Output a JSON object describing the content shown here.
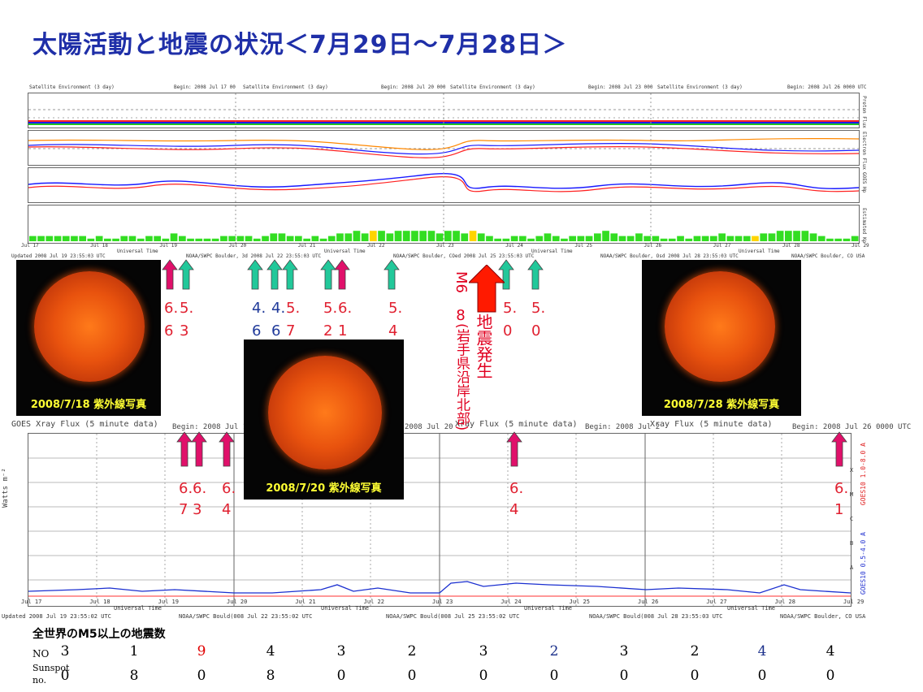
{
  "title": "太陽活動と地震の状況＜7月29日～7月28日＞",
  "top_chart": {
    "header_left": "Satellite Environment  (3 day)",
    "header_begin_1": "Begin:  2008 Jul 17 00",
    "header_mid": "Satellite Environment  (3 day)",
    "header_begin_2": "Begin:  2008 Jul 20 000",
    "header_mid2": "Satellite Environment  (3 day)",
    "header_begin_3": "Begin:  2008 Jul 23 000",
    "header_mid3": "Satellite Environment  (3 day)",
    "header_begin_4": "Begin:  2008 Jul 26 0000 UTC",
    "y_label_1": "Proton Flux",
    "y_label_2": "Electron Flux",
    "y_label_3": "GOES Hp",
    "y_label_4": "Estimated Kp",
    "day_labels": [
      "Jul 17",
      "Jul 18",
      "Jul 19",
      "Jul 20",
      "Jul 21",
      "Jul 22",
      "Jul 23",
      "Jul 24",
      "Jul 25",
      "Jul 26",
      "Jul 27",
      "Jul 28",
      "Jul 29"
    ],
    "universal_time": "Universal Time",
    "footer_1": "Updated 2008 Jul 19 23:55:03 UTC",
    "footer_2": "NOAA/SWPC Boulder, 3d 2008 Jul 22 23:55:03 UTC",
    "footer_3": "NOAA/SWPC Boulder, COed 2008 Jul 25 23:55:03 UTC",
    "footer_4": "NOAA/SWPC Boulder, Osd 2008 Jul 28 23:55:03 UTC",
    "footer_5": "NOAA/SWPC Boulder, CO USA"
  },
  "sun_images": [
    {
      "caption": "2008/7/18 紫外線写真"
    },
    {
      "caption": "2008/7/20 紫外線写真"
    },
    {
      "caption": "2008/7/28 紫外線写真"
    }
  ],
  "arrow_numbers": {
    "a1_top": "6.",
    "a1_bot": "6",
    "a2_top": "5.",
    "a2_bot": "3",
    "b1_top": "4.",
    "b1_bot": "6",
    "b2_top": "4.",
    "b2_bot": "6",
    "b3_top": "5.",
    "b3_bot": "7",
    "c1_top": "5.",
    "c1_bot": "2",
    "c2_top": "6.",
    "c2_bot": "1",
    "d_top": "5.",
    "d_bot": "4",
    "e_top": "5.",
    "e_bot": "0",
    "f_top": "5.",
    "f_bot": "0",
    "x1_top": "6.",
    "x1_bot": "7",
    "x2_top": "6.",
    "x2_bot": "3",
    "x3_top": "6.",
    "x3_bot": "4",
    "x4_top": "6.",
    "x4_bot": "4",
    "x5_top": "6.",
    "x5_bot": "1"
  },
  "earthquake_label": {
    "mag_line1": "M6",
    "mag_line2": "8",
    "vertical_1": "地震発生",
    "vertical_2": "(岩手県沿岸北部)"
  },
  "xray_chart": {
    "header_left": "GOES Xray Flux (5 minute data)",
    "header_begin_1": "Begin:  2008 Jul 17",
    "header_mid": "2008 Jul 20",
    "header_mid2": "Xray Flux (5 minute data)",
    "header_begin_3": "Begin:  2008 Jul 2",
    "header_mid3": "Xray Flux (5 minute data)",
    "header_begin_4": "Begin:  2008 Jul 26  0000 UTC",
    "y_axis": "Watts m⁻²",
    "right_label_1": "GOES10 1.0-8.0 A",
    "right_label_2": "GOES10 0.5-4.0 A",
    "class_labels": [
      "X",
      "M",
      "C",
      "B",
      "A"
    ],
    "day_labels": [
      "Jul 17",
      "Jul 18",
      "Jul 19",
      "Jul 20",
      "Jul 21",
      "Jul 22",
      "Jul 23",
      "Jul 24",
      "Jul 25",
      "Jul 26",
      "Jul 27",
      "Jul 28",
      "Jul 29"
    ],
    "universal_time": "Universal Time",
    "footer_1": "Updated 2008 Jul 19 23:55:02 UTC",
    "footer_2": "NOAA/SWPC Bould(008 Jul 22 23:55:02 UTC",
    "footer_3": "NOAA/SWPC Bould(008 Jul 25 23:55:02 UTC",
    "footer_4": "NOAA/SWPC Bould(008 Jul 28 23:55:03 UTC",
    "footer_5": "NOAA/SWPC Boulder, CO USA"
  },
  "table": {
    "heading": "全世界のM5以上の地震数",
    "row1_label": "NO",
    "row1": [
      "3",
      "1",
      "9",
      "4",
      "3",
      "2",
      "3",
      "2",
      "3",
      "2",
      "4",
      "4"
    ],
    "row1_colors": [
      "#000",
      "#000",
      "#e00000",
      "#000",
      "#000",
      "#000",
      "#000",
      "#1a2f8a",
      "#000",
      "#000",
      "#1a2f8a",
      "#000"
    ],
    "row2_label_1": "Sunspot",
    "row2_label_2": "no.",
    "row2": [
      "0",
      "8",
      "0",
      "8",
      "0",
      "0",
      "0",
      "0",
      "0",
      "0",
      "0",
      "0"
    ]
  },
  "colors": {
    "title": "#1f2fa8",
    "arrow_teal": "#22c89a",
    "arrow_magenta": "#e0106a",
    "arrow_red": "#ff1a00",
    "kp_bar": "#33dd22",
    "kp_bar_yellow": "#ffd400"
  }
}
